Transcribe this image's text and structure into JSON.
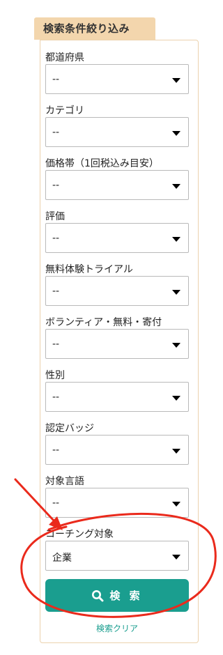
{
  "panel": {
    "title": "検索条件絞り込み"
  },
  "fields": [
    {
      "key": "prefecture",
      "label": "都道府県",
      "value": "--"
    },
    {
      "key": "category",
      "label": "カテゴリ",
      "value": "--"
    },
    {
      "key": "price",
      "label": "価格帯（1回税込み目安）",
      "value": "--"
    },
    {
      "key": "rating",
      "label": "評価",
      "value": "--"
    },
    {
      "key": "free-trial",
      "label": "無料体験トライアル",
      "value": "--"
    },
    {
      "key": "volunteer",
      "label": "ボランティア・無料・寄付",
      "value": "--"
    },
    {
      "key": "gender",
      "label": "性別",
      "value": "--"
    },
    {
      "key": "badge",
      "label": "認定バッジ",
      "value": "--"
    },
    {
      "key": "language",
      "label": "対象言語",
      "value": "--"
    },
    {
      "key": "coaching-target",
      "label": "コーチング対象",
      "value": "企業"
    }
  ],
  "actions": {
    "search_label": "検 索",
    "clear_label": "検索クリア"
  },
  "colors": {
    "tab_background": "#f3d6ad",
    "panel_border": "#ecd2ad",
    "accent": "#1a9e8f",
    "annotation": "#ea2a1c"
  },
  "icons": {
    "search": "search-icon",
    "dropdown": "caret-down-icon",
    "annotation_arrow": "arrow-icon"
  }
}
